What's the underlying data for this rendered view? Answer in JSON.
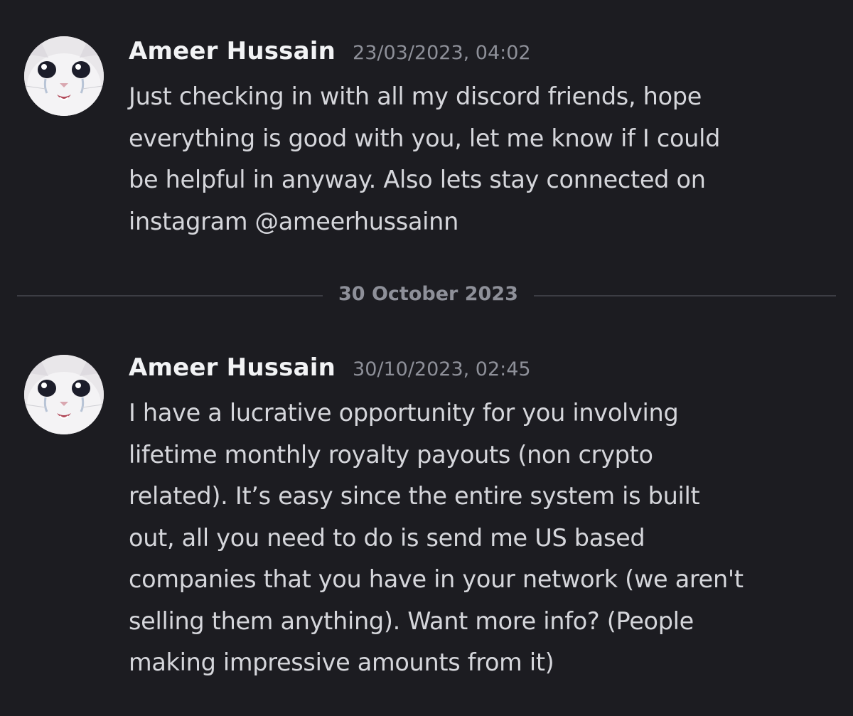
{
  "messages": [
    {
      "author": "Ameer Hussain",
      "timestamp": "23/03/2023, 04:02",
      "lines": [
        "Just checking in with all my discord friends, hope",
        "everything is good with you, let me know if I could",
        "be helpful in anyway. Also lets stay connected on",
        "instagram @ameerhussainn"
      ]
    },
    {
      "author": "Ameer Hussain",
      "timestamp": "30/10/2023, 02:45",
      "lines": [
        "I have a lucrative opportunity for you involving",
        "lifetime monthly royalty payouts (non crypto",
        "related). It’s easy since the entire system is built",
        "out, all you need to do is send me US based",
        "companies that you have in your network (we aren't",
        "selling them anything). Want more info? (People",
        "making impressive amounts from it)"
      ]
    }
  ],
  "date_divider": {
    "label": "30 October 2023"
  },
  "colors": {
    "background": "#1c1c21",
    "author": "#f2f3f5",
    "timestamp": "#8e9099",
    "text": "#d5d6db",
    "divider": "#3c3d44"
  },
  "icons": {
    "avatar": "crying-cat-avatar"
  }
}
